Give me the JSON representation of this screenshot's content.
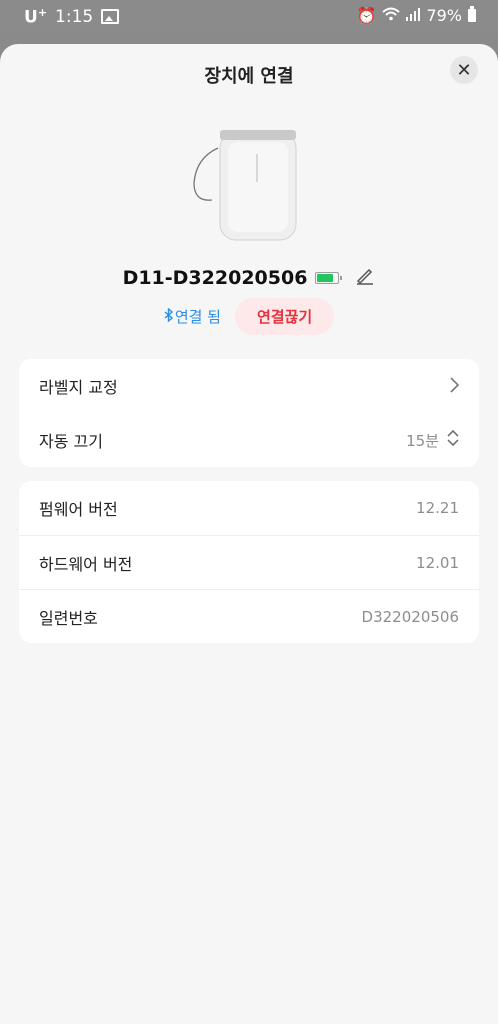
{
  "status_bar": {
    "carrier": "U",
    "carrier_sup": "+",
    "time": "1:15",
    "battery": "79%"
  },
  "sheet": {
    "title": "장치에 연결",
    "close": "✕"
  },
  "device": {
    "name": "D11-D322020506",
    "battery_level": 0.9,
    "status": "연결 됨",
    "disconnect_label": "연결끊기"
  },
  "settings": {
    "calibrate_label": "라벨지 교정",
    "auto_off_label": "자동 끄기",
    "auto_off_value": "15분"
  },
  "info": {
    "firmware_label": "펌웨어 버전",
    "firmware_value": "12.21",
    "hardware_label": "하드웨어 버전",
    "hardware_value": "12.01",
    "serial_label": "일련번호",
    "serial_value": "D322020506"
  },
  "colors": {
    "accent_blue": "#2d8ee6",
    "danger_red": "#e5323c",
    "battery_green": "#22c55e"
  }
}
